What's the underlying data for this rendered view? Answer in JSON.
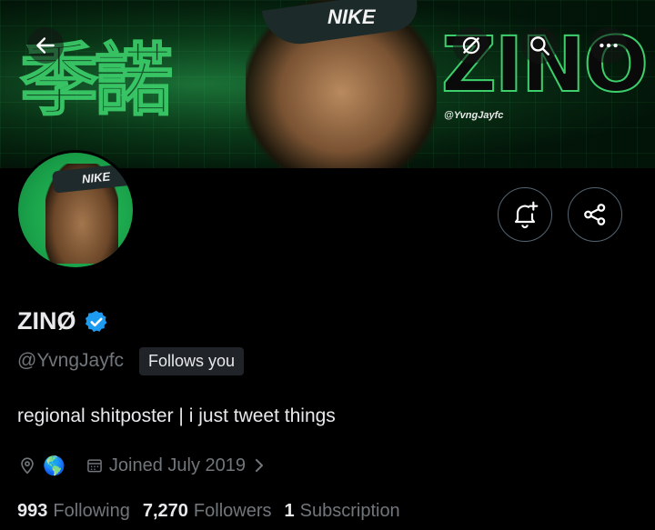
{
  "banner": {
    "kanji_text": "季諾",
    "logo_text": "ZINO",
    "brand_text": "NIKE",
    "watermark_handle": "@YvngJayfc"
  },
  "header_actions": {
    "back": "back-arrow-icon",
    "grok": "grok-icon",
    "search": "search-icon",
    "more": "more-icon"
  },
  "avatar": {
    "brand_text": "NIKE"
  },
  "profile_actions": {
    "notify": "bell-plus-icon",
    "share": "share-icon"
  },
  "profile": {
    "name": "ZINØ",
    "verified": true,
    "handle": "@YvngJayfc",
    "follows_you": "Follows you",
    "bio": "regional shitposter | i just tweet things",
    "location_emoji": "🌎",
    "joined": "Joined July 2019"
  },
  "stats": {
    "following_count": "993",
    "following_label": "Following",
    "followers_count": "7,270",
    "followers_label": "Followers",
    "subscription_count": "1",
    "subscription_label": "Subscription"
  },
  "colors": {
    "background": "#000000",
    "text_primary": "#e7e9ea",
    "text_secondary": "#71767b",
    "verified_blue": "#1d9bf0",
    "banner_green": "#3ccf6b",
    "avatar_green": "#1aa14a"
  }
}
